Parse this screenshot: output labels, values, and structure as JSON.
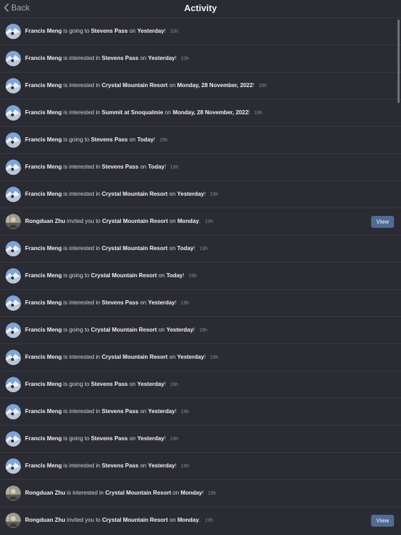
{
  "header": {
    "back_label": "Back",
    "title": "Activity"
  },
  "items": [
    {
      "actor": "Francis Meng",
      "verb": " is going to ",
      "place": "Stevens Pass",
      "on": " on ",
      "when": "Yesterday",
      "end": "!",
      "time": "10h",
      "button": null,
      "avatar": "francis-avatar"
    },
    {
      "actor": "Francis Meng",
      "verb": " is interested in ",
      "place": "Stevens Pass",
      "on": " on ",
      "when": "Yesterday",
      "end": "!",
      "time": "10h",
      "button": null,
      "avatar": "francis-avatar"
    },
    {
      "actor": "Francis Meng",
      "verb": " is interested in ",
      "place": "Crystal Mountain Resort",
      "on": " on ",
      "when": "Monday, 28 November, 2022",
      "end": "!",
      "time": "19h",
      "button": null,
      "avatar": "francis-avatar"
    },
    {
      "actor": "Francis Meng",
      "verb": " is interested in ",
      "place": "Summit at Snoqualmie",
      "on": " on ",
      "when": "Monday, 28 November, 2022",
      "end": "!",
      "time": "19h",
      "button": null,
      "avatar": "francis-avatar"
    },
    {
      "actor": "Francis Meng",
      "verb": " is going to ",
      "place": "Stevens Pass",
      "on": " on ",
      "when": "Today",
      "end": "!",
      "time": "19h",
      "button": null,
      "avatar": "francis-avatar"
    },
    {
      "actor": "Francis Meng",
      "verb": " is interested in ",
      "place": "Stevens Pass",
      "on": " on ",
      "when": "Today",
      "end": "!",
      "time": "19h",
      "button": null,
      "avatar": "francis-avatar"
    },
    {
      "actor": "Francis Meng",
      "verb": " is interested in ",
      "place": "Crystal Mountain Resort",
      "on": " on ",
      "when": "Yesterday",
      "end": "!",
      "time": "19h",
      "button": null,
      "avatar": "francis-avatar"
    },
    {
      "actor": "Rongduan Zhu",
      "verb": " invited you to ",
      "place": "Crystal Mountain Resort",
      "on": " on ",
      "when": "Monday",
      "end": ".",
      "time": "19h",
      "button": "View",
      "avatar": "rongduan-avatar"
    },
    {
      "actor": "Francis Meng",
      "verb": " is interested in ",
      "place": "Crystal Mountain Resort",
      "on": " on ",
      "when": "Today",
      "end": "!",
      "time": "19h",
      "button": null,
      "avatar": "francis-avatar"
    },
    {
      "actor": "Francis Meng",
      "verb": " is going to ",
      "place": "Crystal Mountain Resort",
      "on": " on ",
      "when": "Today",
      "end": "!",
      "time": "19h",
      "button": null,
      "avatar": "francis-avatar"
    },
    {
      "actor": "Francis Meng",
      "verb": " is interested in ",
      "place": "Stevens Pass",
      "on": " on ",
      "when": "Yesterday",
      "end": "!",
      "time": "19h",
      "button": null,
      "avatar": "francis-avatar"
    },
    {
      "actor": "Francis Meng",
      "verb": " is going to ",
      "place": "Crystal Mountain Resort",
      "on": " on ",
      "when": "Yesterday",
      "end": "!",
      "time": "19h",
      "button": null,
      "avatar": "francis-avatar"
    },
    {
      "actor": "Francis Meng",
      "verb": " is interested in ",
      "place": "Crystal Mountain Resort",
      "on": " on ",
      "when": "Yesterday",
      "end": "!",
      "time": "19h",
      "button": null,
      "avatar": "francis-avatar"
    },
    {
      "actor": "Francis Meng",
      "verb": " is going to ",
      "place": "Stevens Pass",
      "on": " on ",
      "when": "Yesterday",
      "end": "!",
      "time": "19h",
      "button": null,
      "avatar": "francis-avatar"
    },
    {
      "actor": "Francis Meng",
      "verb": " is interested in ",
      "place": "Stevens Pass",
      "on": " on ",
      "when": "Yesterday",
      "end": "!",
      "time": "19h",
      "button": null,
      "avatar": "francis-avatar"
    },
    {
      "actor": "Francis Meng",
      "verb": " is going to ",
      "place": "Stevens Pass",
      "on": " on ",
      "when": "Yesterday",
      "end": "!",
      "time": "19h",
      "button": null,
      "avatar": "francis-avatar"
    },
    {
      "actor": "Francis Meng",
      "verb": " is interested in ",
      "place": "Stevens Pass",
      "on": " on ",
      "when": "Yesterday",
      "end": "!",
      "time": "19h",
      "button": null,
      "avatar": "francis-avatar"
    },
    {
      "actor": "Rongduan Zhu",
      "verb": " is interested in ",
      "place": "Crystal Mountain Resort",
      "on": " on ",
      "when": "Monday",
      "end": "!",
      "time": "19h",
      "button": null,
      "avatar": "rongduan-avatar"
    },
    {
      "actor": "Rongduan Zhu",
      "verb": " invited you to ",
      "place": "Crystal Mountain Resort",
      "on": " on ",
      "when": "Monday",
      "end": ".",
      "time": "19h",
      "button": "View",
      "avatar": "rongduan-avatar"
    }
  ],
  "colors": {
    "background": "#2b2b33",
    "divider": "#393942",
    "view_button": "#4f6c96",
    "muted_text": "#8a8a93"
  }
}
